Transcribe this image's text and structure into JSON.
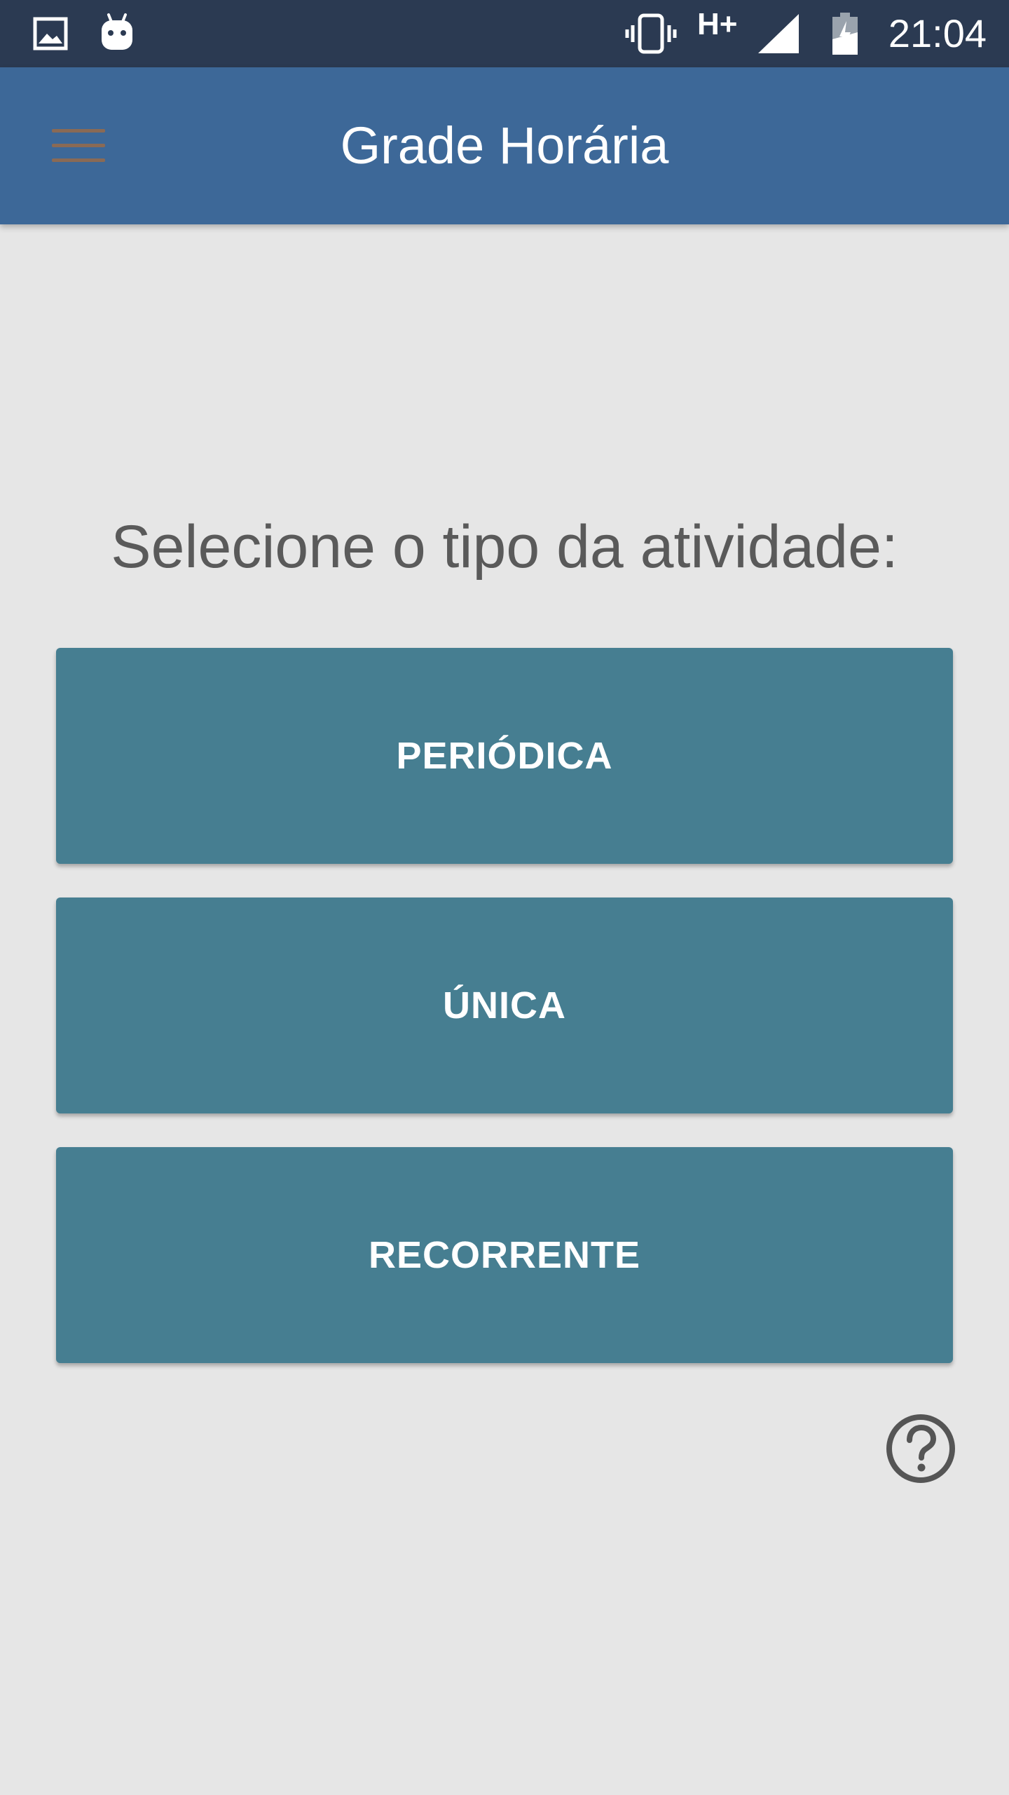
{
  "status_bar": {
    "time": "21:04",
    "network": "H+",
    "icons": [
      "gallery-icon",
      "android-icon",
      "vibrate-icon",
      "signal-icon",
      "battery-charging-icon"
    ]
  },
  "app_bar": {
    "title": "Grade Horária",
    "menu_icon": "hamburger-menu-icon"
  },
  "main": {
    "prompt": "Selecione o tipo da atividade:",
    "buttons": [
      {
        "label": "PERIÓDICA"
      },
      {
        "label": "ÚNICA"
      },
      {
        "label": "RECORRENTE"
      }
    ],
    "help_icon": "help-circle-icon"
  },
  "colors": {
    "status_bar": "#2b3a52",
    "app_bar": "#3d6898",
    "background": "#e6e6e6",
    "button": "#467e91",
    "button_text": "#ffffff",
    "prompt_text": "#5a5a5a",
    "menu_lines": "#8a6a55"
  }
}
